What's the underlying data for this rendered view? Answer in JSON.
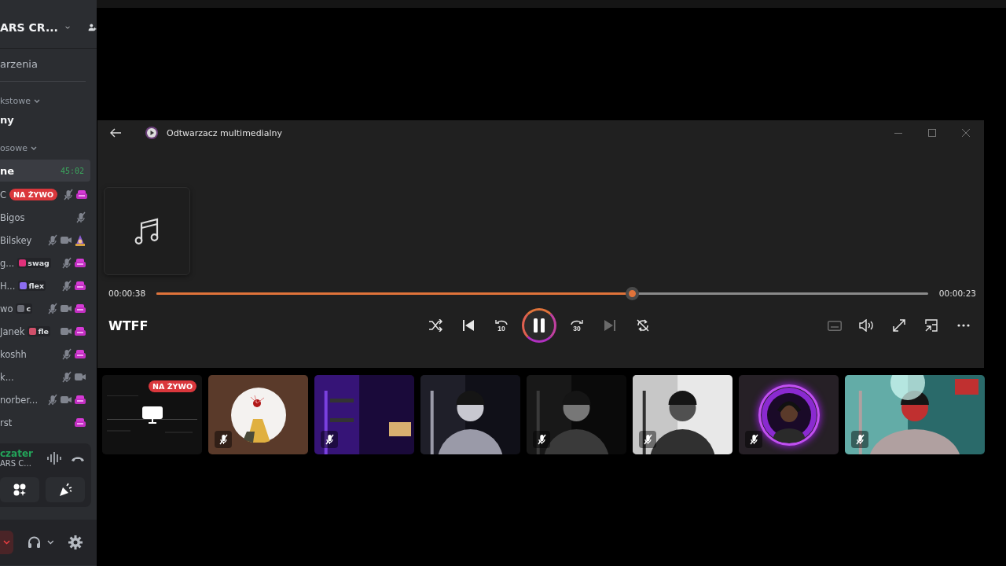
{
  "sidebar": {
    "server_name": "ARS CR...",
    "events_label": "arzenia",
    "sections": [
      {
        "kind": "category",
        "label": "kstowe"
      },
      {
        "kind": "channel",
        "label": "ny"
      },
      {
        "kind": "category",
        "label": "osowe"
      },
      {
        "kind": "voice",
        "label": "ne",
        "time": "45:02",
        "selected": true
      }
    ],
    "members": [
      {
        "name": "C",
        "live": "NA ŻYWO",
        "icons": [
          {
            "kind": "mic-off"
          },
          {
            "kind": "activity"
          }
        ]
      },
      {
        "name": "Bigos",
        "icons": [
          {
            "kind": "mic-off"
          }
        ]
      },
      {
        "name": "Bilskey",
        "icons": [
          {
            "kind": "mic-off"
          },
          {
            "kind": "camera"
          },
          {
            "kind": "wizard"
          }
        ]
      },
      {
        "name": "g...",
        "tag": {
          "text": "swag",
          "color": "#e0307a"
        },
        "icons": [
          {
            "kind": "mic-off"
          },
          {
            "kind": "activity"
          }
        ]
      },
      {
        "name": "H...",
        "tag": {
          "text": "flex",
          "color": "#8b6cf0"
        },
        "icons": [
          {
            "kind": "mic-off"
          },
          {
            "kind": "activity"
          }
        ]
      },
      {
        "name": "wo",
        "tag": {
          "text": "c",
          "color": "#6d6f78"
        },
        "icons": [
          {
            "kind": "mic-off"
          },
          {
            "kind": "camera"
          },
          {
            "kind": "activity"
          }
        ]
      },
      {
        "name": "Janek",
        "tag": {
          "text": "fle",
          "color": "#d0506a"
        },
        "icons": [
          {
            "kind": "camera"
          },
          {
            "kind": "activity"
          }
        ]
      },
      {
        "name": "koshh",
        "icons": [
          {
            "kind": "mic-off"
          },
          {
            "kind": "activity"
          }
        ]
      },
      {
        "name": "k...",
        "icons": [
          {
            "kind": "mic-off"
          },
          {
            "kind": "camera"
          }
        ]
      },
      {
        "name": "norber...",
        "icons": [
          {
            "kind": "mic-off"
          },
          {
            "kind": "camera"
          },
          {
            "kind": "activity"
          }
        ]
      },
      {
        "name": "rst",
        "icons": [
          {
            "kind": "activity"
          }
        ]
      }
    ],
    "voice_panel": {
      "status": "czater",
      "server": "ARS C..."
    },
    "user_bar": {
      "mic_muted": true
    }
  },
  "player": {
    "title": "Odtwarzacz multimedialny",
    "elapsed": "00:00:38",
    "remaining": "00:00:23",
    "level": 0.616,
    "track": "WTFF",
    "playing": true,
    "controls": [
      {
        "kind": "shuffle",
        "disabled": false
      },
      {
        "kind": "previous",
        "disabled": false
      },
      {
        "kind": "rewind",
        "label": "10",
        "disabled": false
      },
      {
        "kind": "play"
      },
      {
        "kind": "forward",
        "label": "30",
        "disabled": false
      },
      {
        "kind": "next",
        "disabled": true
      },
      {
        "kind": "repeat",
        "disabled": false
      }
    ],
    "extra_controls": [
      {
        "kind": "captions",
        "disabled": true
      },
      {
        "kind": "volume",
        "disabled": false
      },
      {
        "kind": "fullscreen",
        "disabled": false
      },
      {
        "kind": "miniplayer",
        "disabled": false
      },
      {
        "kind": "more",
        "disabled": false
      }
    ]
  },
  "stream_tiles": [
    {
      "kind": "screen",
      "live": "NA ŻYWO",
      "muted": false
    },
    {
      "kind": "avatar",
      "muted": true
    },
    {
      "kind": "video",
      "muted": true
    },
    {
      "kind": "video",
      "muted": false
    },
    {
      "kind": "video",
      "muted": true
    },
    {
      "kind": "video",
      "muted": true
    },
    {
      "kind": "avatar-ring",
      "muted": true
    },
    {
      "kind": "video",
      "muted": true
    }
  ]
}
